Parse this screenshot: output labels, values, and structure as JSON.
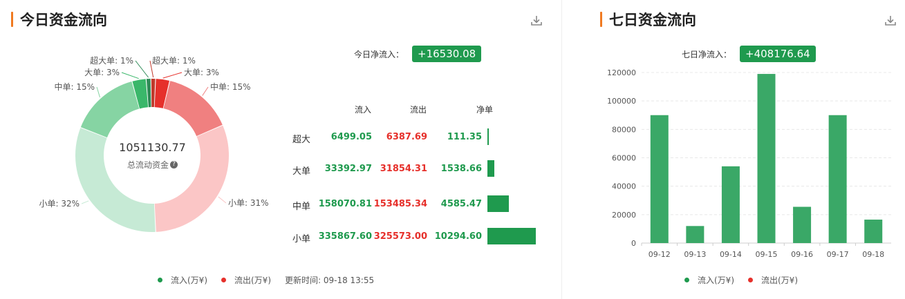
{
  "left_panel": {
    "title": "今日资金流向",
    "download_icon": "download-icon",
    "net_inflow_label": "今日净流入：",
    "net_inflow_value": "+16530.08",
    "center_value": "1051130.77",
    "center_label": "总流动资金",
    "help_icon": "question-circle-icon",
    "table": {
      "headers": [
        "流入",
        "流出",
        "净单"
      ],
      "rows": [
        {
          "label": "超大",
          "inflow": "6499.05",
          "outflow": "6387.69",
          "net": "111.35",
          "net_value": 111.35
        },
        {
          "label": "大单",
          "inflow": "33392.97",
          "outflow": "31854.31",
          "net": "1538.66",
          "net_value": 1538.66
        },
        {
          "label": "中单",
          "inflow": "158070.81",
          "outflow": "153485.34",
          "net": "4585.47",
          "net_value": 4585.47
        },
        {
          "label": "小单",
          "inflow": "335867.60",
          "outflow": "325573.00",
          "net": "10294.60",
          "net_value": 10294.6
        }
      ]
    },
    "legend": {
      "inflow": "流入(万¥)",
      "outflow": "流出(万¥)"
    },
    "update_text": "更新时间: 09-18 13:55"
  },
  "right_panel": {
    "title": "七日资金流向",
    "download_icon": "download-icon",
    "net_inflow_label": "七日净流入：",
    "net_inflow_value": "+408176.64",
    "legend": {
      "inflow": "流入(万¥)",
      "outflow": "流出(万¥)"
    }
  },
  "colors": {
    "inflow": "#1f9a4e",
    "outflow": "#e6302b",
    "accent": "#f07a21",
    "bar": "#3aa867"
  },
  "chart_data": [
    {
      "type": "pie",
      "donut": true,
      "slices": [
        {
          "label": "超大单: 1%",
          "value": 1,
          "color": "#2e8b57"
        },
        {
          "label": "超大单: 1%",
          "value": 1,
          "color": "#c0392b"
        },
        {
          "label": "大单: 3%",
          "value": 3,
          "color": "#e6302b"
        },
        {
          "label": "中单: 15%",
          "value": 15,
          "color": "#f08080"
        },
        {
          "label": "小单: 31%",
          "value": 31,
          "color": "#fbc6c6"
        },
        {
          "label": "小单: 32%",
          "value": 32,
          "color": "#c6ead5"
        },
        {
          "label": "中单: 15%",
          "value": 15,
          "color": "#86d4a3"
        },
        {
          "label": "大单: 3%",
          "value": 3,
          "color": "#3ab76a"
        }
      ]
    },
    {
      "type": "bar",
      "categories": [
        "09-12",
        "09-13",
        "09-14",
        "09-15",
        "09-16",
        "09-17",
        "09-18"
      ],
      "values": [
        90000,
        12000,
        54000,
        119000,
        25500,
        90000,
        16500
      ],
      "ylim": [
        0,
        120000
      ],
      "yticks": [
        "0",
        "20000",
        "40000",
        "60000",
        "80000",
        "100000",
        "120000"
      ],
      "grid": true
    }
  ]
}
